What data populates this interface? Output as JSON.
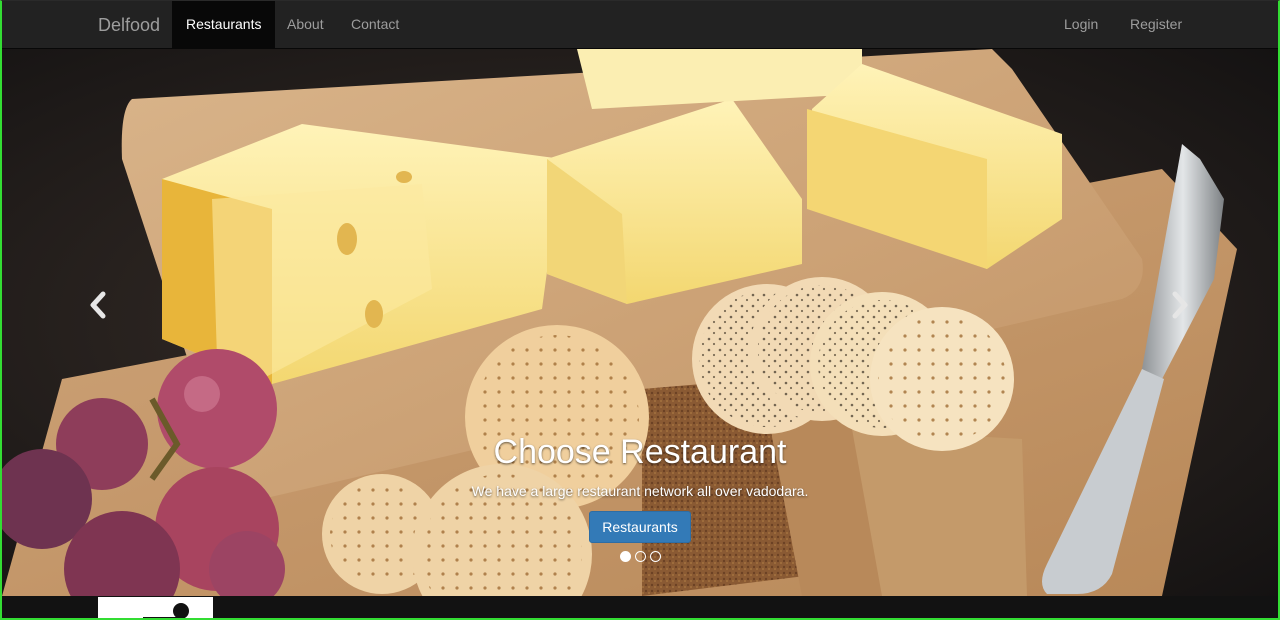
{
  "navbar": {
    "brand": "Delfood",
    "links": [
      {
        "label": "Restaurants",
        "active": true
      },
      {
        "label": "About",
        "active": false
      },
      {
        "label": "Contact",
        "active": false
      }
    ],
    "right_links": [
      {
        "label": "Login"
      },
      {
        "label": "Register"
      }
    ]
  },
  "carousel": {
    "caption_title": "Choose Restaurant",
    "caption_text": "We have a large restaurant network all over vadodara.",
    "button_label": "Restaurants",
    "slide_count": 3,
    "active_slide": 1
  },
  "colors": {
    "navbar": "#222222",
    "active_tab": "#080808",
    "primary_button": "#337ab7",
    "frame_border": "#33dd33"
  },
  "icons": [
    "chevron-left-icon",
    "chevron-right-icon",
    "avatar-icon"
  ]
}
